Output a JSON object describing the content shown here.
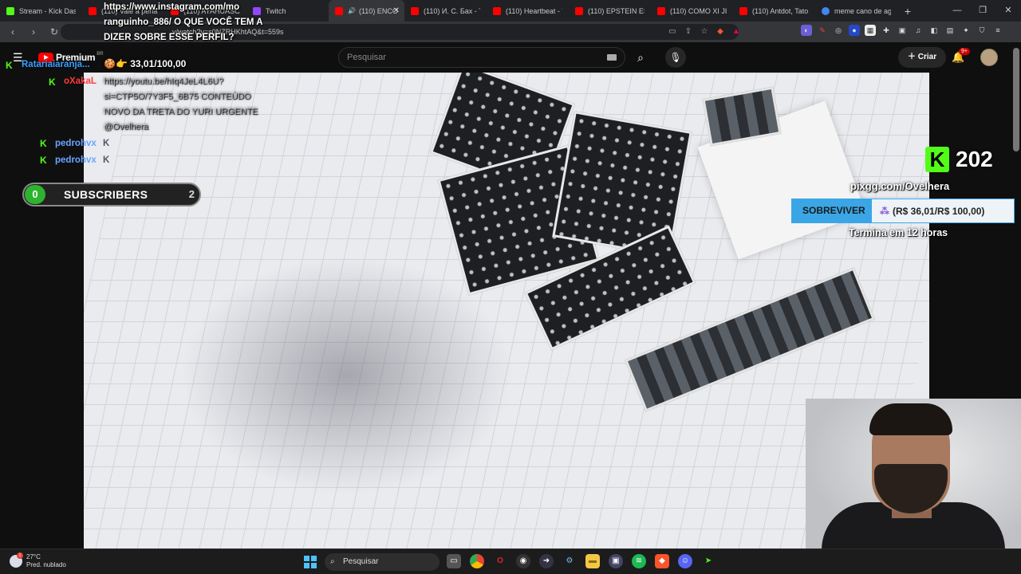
{
  "browser": {
    "tabs": [
      {
        "title": "Stream - Kick Dashb",
        "color": "#53fc18"
      },
      {
        "title": "(110) Vale a pena u",
        "color": "#ff0000"
      },
      {
        "title": "(110) AYAHUASCA",
        "color": "#ff0000"
      },
      {
        "title": "Twitch",
        "color": "#9146ff"
      },
      {
        "title": "(110) ENCO",
        "color": "#ff0000",
        "active": true
      },
      {
        "title": "(110) И. С. Бах - To",
        "color": "#ff0000"
      },
      {
        "title": "(110) Heartbeat - Yo",
        "color": "#ff0000"
      },
      {
        "title": "(110) EPSTEIN ESTÁ",
        "color": "#ff0000"
      },
      {
        "title": "(110) COMO XI JIN",
        "color": "#ff0000"
      },
      {
        "title": "(110) Antdot, Tato,",
        "color": "#ff0000"
      },
      {
        "title": "meme cano de agu",
        "color": "#4285f4"
      }
    ],
    "url": "v/watch?v=s0NZRHKhtAQ&t=559s"
  },
  "youtube": {
    "logo_text": "Premium",
    "region": "BR",
    "search_placeholder": "Pesquisar",
    "create_label": "Criar",
    "notif_badge": "9+"
  },
  "overlay": {
    "instagram_text": "https://www.instagram.com/mo ranguinho_886/ O QUE VOCÊ TEM A DIZER SOBRE ESSE PERFIL?",
    "progress_text": "33,01/100,00",
    "faded_text": "https://youtu.be/hIq4JeL4L6U? si=CTP5O/7Y3F5_6B75 CONTEÚDO NOVO DA TRETA DO YURI URGENTE @Ovelhera",
    "chat": [
      {
        "name": "Ratariaiaranja...",
        "color": "#3aa0ff"
      },
      {
        "name": "oXakaL",
        "color": "#ff3b3b"
      },
      {
        "name": "pedrohvx",
        "color": "#6aa5ff",
        "msg": "K"
      },
      {
        "name": "pedrohvx",
        "color": "#6aa5ff",
        "msg": "K"
      }
    ],
    "subscribers": {
      "label": "SUBSCRIBERS",
      "current": "0",
      "goal": "2"
    },
    "kick_count": "202",
    "pix_url": "pixgg.com/Ovelhera",
    "goal_label": "SOBREVIVER",
    "goal_value": "(R$ 36,01/R$ 100,00)",
    "goal_fraction": 0.3601,
    "ends_text": "Termina em 12 horas"
  },
  "taskbar": {
    "temp": "27°C",
    "weather_desc": "Pred. nublado",
    "weather_badge": "1",
    "search_placeholder": "Pesquisar",
    "apps": [
      "file-explorer-icon",
      "chrome-icon",
      "opera-icon",
      "obs-icon",
      "arrow-app-icon",
      "steam-icon",
      "folder-icon",
      "capture-icon",
      "spotify-icon",
      "brave-icon",
      "discord-icon",
      "kick-app-icon"
    ]
  }
}
